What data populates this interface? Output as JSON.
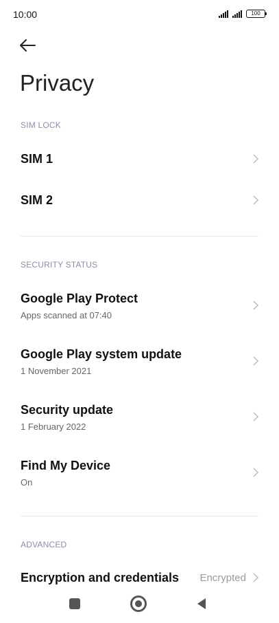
{
  "status_bar": {
    "time": "10:00",
    "battery_level": "100",
    "signal_icons": [
      "signal-bars-icon",
      "signal-bars-icon"
    ]
  },
  "header": {
    "back_icon": "arrow-left-icon",
    "title": "Privacy"
  },
  "sections": {
    "sim_lock": {
      "header": "SIM LOCK",
      "items": [
        {
          "title": "SIM 1"
        },
        {
          "title": "SIM 2"
        }
      ]
    },
    "security_status": {
      "header": "SECURITY STATUS",
      "items": [
        {
          "title": "Google Play Protect",
          "subtitle": "Apps scanned at 07:40"
        },
        {
          "title": "Google Play system update",
          "subtitle": "1 November 2021"
        },
        {
          "title": "Security update",
          "subtitle": "1 February 2022"
        },
        {
          "title": "Find My Device",
          "subtitle": "On"
        }
      ]
    },
    "advanced": {
      "header": "ADVANCED",
      "items": [
        {
          "title": "Encryption and credentials",
          "value": "Encrypted"
        }
      ]
    }
  },
  "nav_bar": {
    "icons": [
      "square-recents-icon",
      "circle-home-icon",
      "triangle-back-icon"
    ]
  },
  "colors": {
    "section_header": "#8a8fa3",
    "divider": "#e6e6e6",
    "chevron": "#bbbbbb"
  }
}
